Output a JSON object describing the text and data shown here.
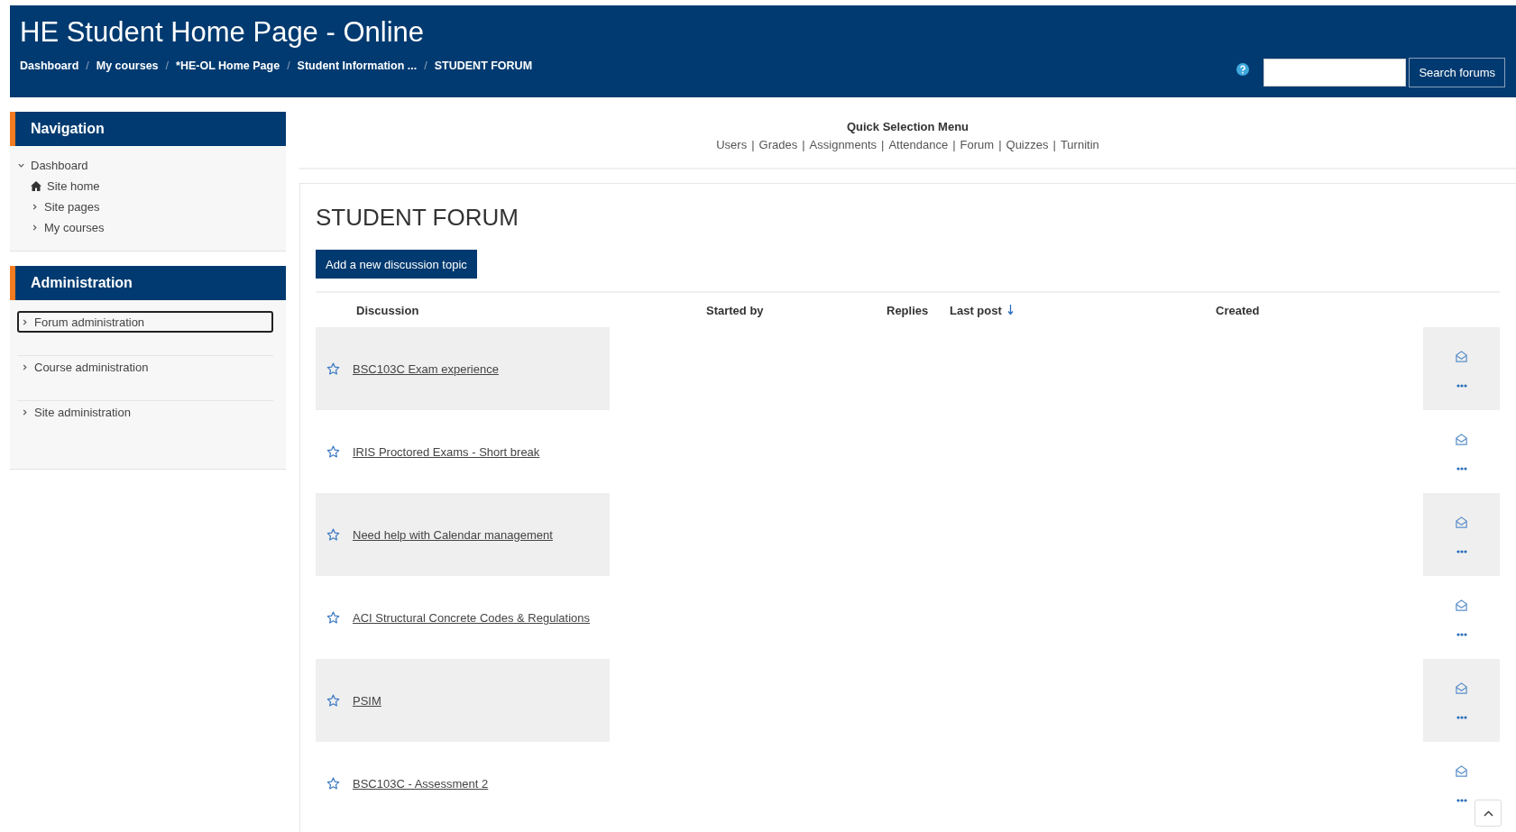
{
  "header": {
    "title": "HE Student Home Page - Online",
    "breadcrumb": {
      "separator": "/",
      "items": [
        "Dashboard",
        "My courses",
        "*HE-OL Home Page",
        "Student Information ...",
        "STUDENT FORUM"
      ]
    },
    "search": {
      "button": "Search forums"
    }
  },
  "sidebar": {
    "blocks": [
      {
        "title": "Navigation",
        "items": [
          {
            "label": "Dashboard",
            "kind": "branch",
            "expanded": true,
            "children": [
              {
                "label": "Site home",
                "kind": "home"
              },
              {
                "label": "Site pages",
                "kind": "branch",
                "expanded": false
              },
              {
                "label": "My courses",
                "kind": "branch",
                "expanded": false
              }
            ]
          }
        ]
      },
      {
        "title": "Administration",
        "items": [
          {
            "label": "Forum administration",
            "kind": "branch",
            "expanded": false,
            "selected": true
          },
          {
            "label": "Course administration",
            "kind": "branch",
            "expanded": false,
            "selected": false
          },
          {
            "label": "Site administration",
            "kind": "branch",
            "expanded": false,
            "selected": false
          }
        ]
      }
    ]
  },
  "quick_menu": {
    "title": "Quick Selection Menu",
    "separator": "|",
    "links": [
      "Users",
      "Grades",
      "Assignments",
      "Attendance",
      "Forum",
      "Quizzes",
      "Turnitin"
    ]
  },
  "forum": {
    "heading": "STUDENT FORUM",
    "add_button": "Add a new discussion topic",
    "columns": [
      {
        "label": "Discussion",
        "sorted": false
      },
      {
        "label": "Started by",
        "sorted": false
      },
      {
        "label": "Replies",
        "sorted": false
      },
      {
        "label": "Last post",
        "sorted": true
      },
      {
        "label": "Created",
        "sorted": false
      }
    ],
    "rows": [
      {
        "title": "BSC103C Exam experience",
        "starred": false
      },
      {
        "title": "IRIS Proctored Exams - Short break",
        "starred": false
      },
      {
        "title": "Need help with Calendar management",
        "starred": false
      },
      {
        "title": "ACI Structural Concrete Codes & Regulations",
        "starred": false
      },
      {
        "title": "PSIM",
        "starred": false
      },
      {
        "title": "BSC103C - Assessment 2",
        "starred": false
      }
    ]
  }
}
